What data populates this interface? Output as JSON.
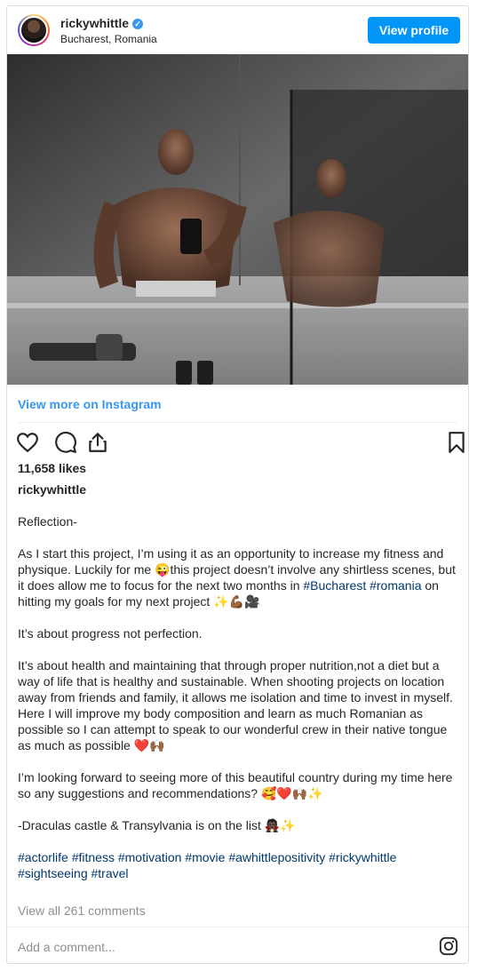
{
  "header": {
    "username": "rickywhittle",
    "verified_mark": "✓",
    "location": "Bucharest, Romania",
    "view_profile_label": "View profile"
  },
  "media": {
    "description_icon": "mirror-selfie-photo"
  },
  "view_more_label": "View more on Instagram",
  "actions": {
    "like_icon": "heart-icon",
    "comment_icon": "comment-icon",
    "share_icon": "share-icon",
    "save_icon": "bookmark-icon"
  },
  "likes": "11,658 likes",
  "caption": {
    "username": "rickywhittle",
    "p1": "Reflection-",
    "p2a": "As I start this project, I’m using it as an opportunity to increase my fitness and physique. Luckily for me 😜this project doesn’t involve any shirtless scenes, but it does allow me to focus for the next two months in ",
    "p2tag1": "#Bucharest",
    "p2tag2": "#romania",
    "p2b": " on hitting my goals for my next project ✨💪🏾🎥",
    "p3": "It’s about progress not perfection.",
    "p4": "It’s about health and maintaining that through proper nutrition,not a diet but a way of life that is healthy and sustainable. When shooting projects on location away from friends and family, it allows me isolation and time to invest in myself.",
    "p5": "Here I will improve my body composition and learn as much Romanian as possible so I can attempt to speak to our wonderful crew in their native tongue as much as possible ❤️🙌🏾",
    "p6": "I’m looking forward to seeing more of this beautiful country during my time here so any suggestions and recommendations? 🥰❤️🙌🏾✨",
    "p7": "-Draculas castle & Transylvania is on the list 🧛🏿✨",
    "hashtags": "#actorlife #fitness #motivation #movie #awhittlepositivity #rickywhittle #sightseeing #travel"
  },
  "comments_link": "View all 261 comments",
  "comment_input": {
    "placeholder": "Add a comment...",
    "icon": "instagram-icon"
  },
  "colors": {
    "accent": "#0095f6",
    "link": "#3897f0",
    "hashtag": "#00376b",
    "muted": "#8e8e8e"
  }
}
